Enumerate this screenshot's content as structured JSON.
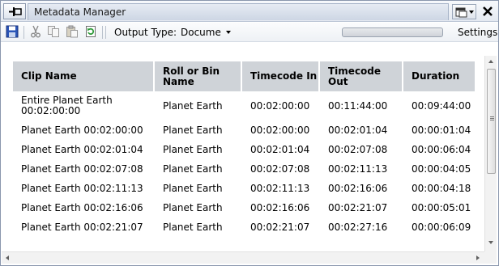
{
  "window": {
    "title": "Metadata Manager"
  },
  "toolbar": {
    "output_type_label": "Output Type:",
    "output_type_value": "Docume",
    "settings_label": "Settings",
    "icons": [
      "save-icon",
      "cut-icon",
      "copy-icon",
      "paste-icon",
      "refresh-icon"
    ]
  },
  "table": {
    "headers": [
      "Clip Name",
      "Roll or Bin Name",
      "Timecode In",
      "Timecode Out",
      "Duration"
    ],
    "rows": [
      [
        "Entire Planet Earth 00:02:00:00",
        "Planet Earth",
        "00:02:00:00",
        "00:11:44:00",
        "00:09:44:00"
      ],
      [
        "Planet Earth 00:02:00:00",
        "Planet Earth",
        "00:02:00:00",
        "00:02:01:04",
        "00:00:01:04"
      ],
      [
        "Planet Earth 00:02:01:04",
        "Planet Earth",
        "00:02:01:04",
        "00:02:07:08",
        "00:00:06:04"
      ],
      [
        "Planet Earth 00:02:07:08",
        "Planet Earth",
        "00:02:07:08",
        "00:02:11:13",
        "00:00:04:05"
      ],
      [
        "Planet Earth 00:02:11:13",
        "Planet Earth",
        "00:02:11:13",
        "00:02:16:06",
        "00:00:04:18"
      ],
      [
        "Planet Earth 00:02:16:06",
        "Planet Earth",
        "00:02:16:06",
        "00:02:21:07",
        "00:00:05:01"
      ],
      [
        "Planet Earth 00:02:21:07",
        "Planet Earth",
        "00:02:21:07",
        "00:02:27:16",
        "00:00:06:09"
      ]
    ]
  },
  "colors": {
    "header_bg": "#cfd3d8",
    "title_bg": "#dde3ec",
    "save_blue": "#2a55b8",
    "refresh_green": "#2f9a3a"
  }
}
